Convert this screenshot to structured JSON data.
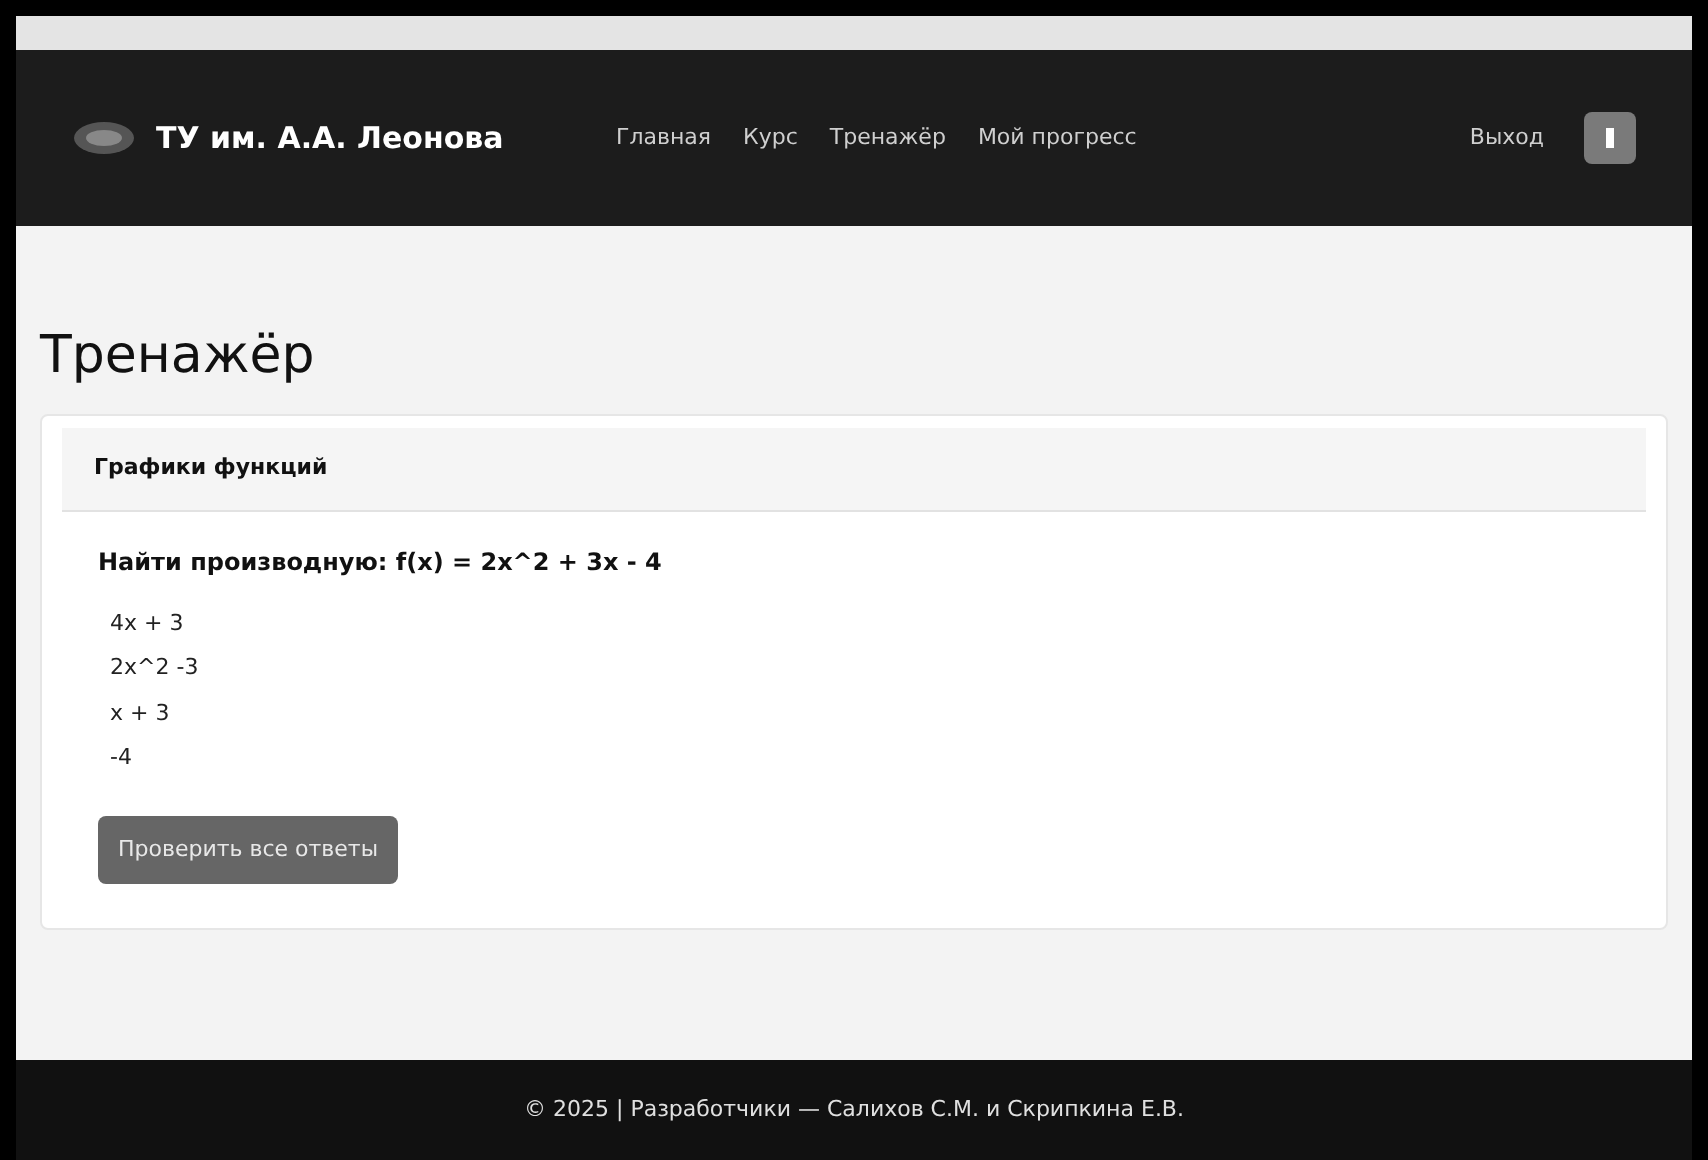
{
  "navbar": {
    "brand": "ТУ им. А.А. Леонова",
    "links": [
      {
        "label": "Главная"
      },
      {
        "label": "Курс"
      },
      {
        "label": "Тренажёр"
      },
      {
        "label": "Мой прогресс"
      }
    ],
    "logout": "Выход"
  },
  "page_title": "Тренажёр",
  "card": {
    "header": "Графики функций",
    "question": "Найти производную: f(x) = 2x^2 + 3x - 4",
    "options": [
      "4x + 3",
      "2x^2 -3",
      "x + 3",
      "-4"
    ],
    "button": "Проверить все ответы"
  },
  "footer": "© 2025 | Разработчики — Салихов С.М. и Скрипкина Е.В."
}
